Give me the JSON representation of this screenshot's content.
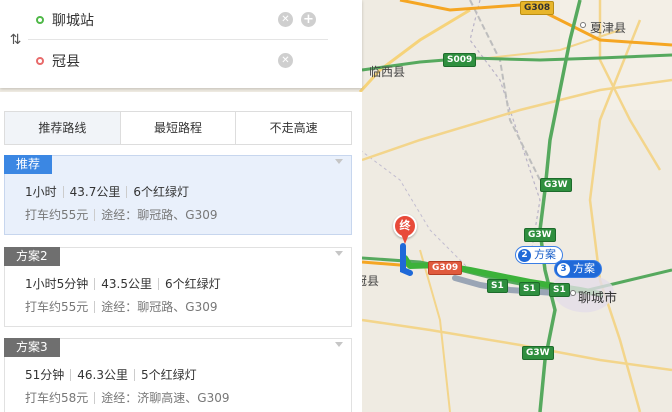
{
  "search": {
    "start": "聊城站",
    "end": "冠县"
  },
  "tabs": [
    {
      "label": "推荐路线",
      "active": true
    },
    {
      "label": "最短路程",
      "active": false
    },
    {
      "label": "不走高速",
      "active": false
    }
  ],
  "plans": [
    {
      "badge": "推荐",
      "time": "1小时",
      "distance": "43.7公里",
      "lights": "6个红绿灯",
      "taxi": "打车约55元",
      "via": "途经：聊冠路、G309",
      "selected": true
    },
    {
      "badge": "方案2",
      "time": "1小时5分钟",
      "distance": "43.5公里",
      "lights": "6个红绿灯",
      "taxi": "打车约55元",
      "via": "途经：聊冠路、G309",
      "selected": false
    },
    {
      "badge": "方案3",
      "time": "51分钟",
      "distance": "46.3公里",
      "lights": "5个红绿灯",
      "taxi": "打车约58元",
      "via": "途经：济聊高速、G309",
      "selected": false
    }
  ],
  "map": {
    "cities": {
      "linxi": "临西县",
      "xiajin": "夏津县",
      "liaocheng": "聊城市",
      "guan": "冠县"
    },
    "shields": {
      "g308": "G308",
      "s009": "S009",
      "g3w_a": "G3W",
      "g3w_b": "G3W",
      "g3w_c": "G3W",
      "g309": "G309",
      "s1_a": "S1",
      "s1_b": "S1",
      "s1_c": "S1"
    },
    "route_tags": [
      {
        "num": "2",
        "label": "方案"
      },
      {
        "num": "3",
        "label": "方案"
      }
    ],
    "end_marker": "终",
    "colors": {
      "route": "#3cb23a",
      "route_alt": "#1f69d8",
      "end_marker": "#e84a3a",
      "badge_active": "#3b87e3"
    }
  }
}
